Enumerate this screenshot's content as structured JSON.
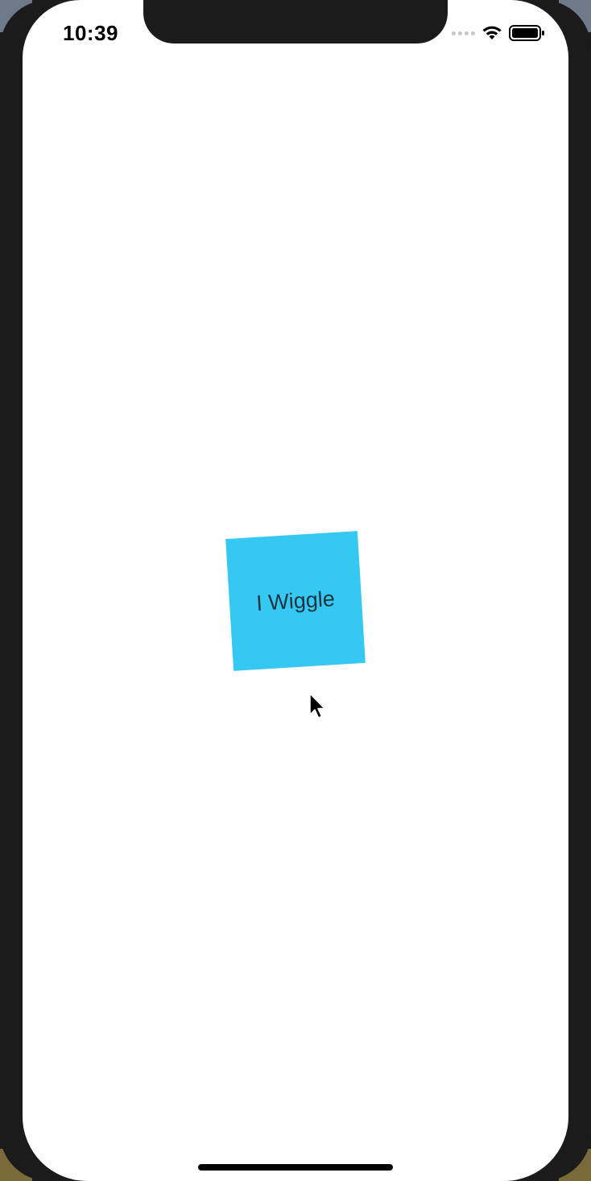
{
  "status_bar": {
    "time": "10:39",
    "icons": [
      "signal-dots-icon",
      "wifi-icon",
      "battery-icon"
    ]
  },
  "main": {
    "box_label": "I Wiggle",
    "box_color": "#35c8f3"
  },
  "cursor": {
    "icon": "mouse-pointer-icon"
  }
}
